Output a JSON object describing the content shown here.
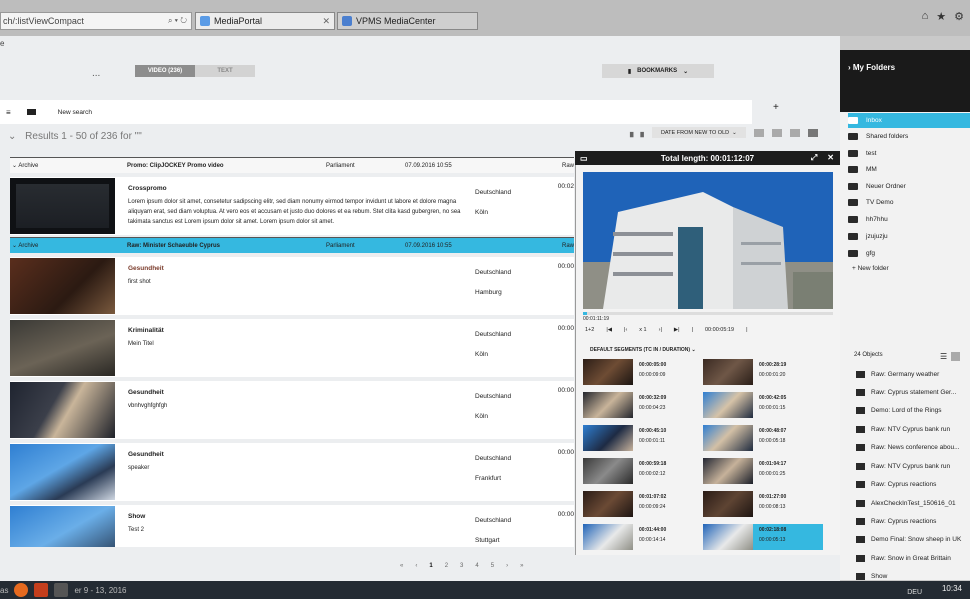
{
  "browser": {
    "address": "ch/:listViewCompact",
    "tabs": [
      {
        "label": "MediaPortal"
      },
      {
        "label": "VPMS MediaCenter"
      }
    ],
    "toolbar_icons": [
      "home-icon",
      "star-icon",
      "gear-icon"
    ]
  },
  "app": {
    "menu_char": "e",
    "tabs": {
      "video": "VIDEO (236)",
      "text": "TEXT"
    },
    "bookmarks": "BOOKMARKS",
    "ellipsis": "...",
    "new_search": "New search",
    "plus": "+",
    "results": "Results 1 - 50 of 236 for \"\"",
    "sort": "DATE FROM NEW TO OLD"
  },
  "list": {
    "rows": [
      {
        "archive": "Archive",
        "title": "Promo: ClipJOCKEY Promo video",
        "source": "Parliament",
        "date": "07.09.2016 10:55",
        "type": "Raw",
        "detail": {
          "title": "Crosspromo",
          "desc": "Lorem ipsum dolor sit amet, consetetur sadipscing elitr, sed diam nonumy eirmod tempor invidunt ut labore et dolore magna aliquyam erat, sed diam voluptua. At vero eos et accusam et justo duo dolores et ea rebum. Stet clita kasd gubergren, no sea takimata sanctus est Lorem ipsum dolor sit amet. Lorem ipsum dolor sit amet.",
          "country": "Deutschland",
          "city": "Köln",
          "duration": "00:02"
        }
      },
      {
        "archive": "Archive",
        "title": "Raw: Minister Schaeuble Cyprus",
        "source": "Parliament",
        "date": "07.09.2016 10:55",
        "type": "Raw",
        "detail": {
          "title": "Gesundheit",
          "desc": "first shot",
          "country": "Deutschland",
          "city": "Hamburg",
          "duration": "00:00"
        }
      }
    ],
    "items": [
      {
        "title": "Kriminalität",
        "desc": "Mein Titel",
        "country": "Deutschland",
        "city": "Köln",
        "duration": "00:00"
      },
      {
        "title": "Gesundheit",
        "desc": "vbnhvghfghfgh",
        "country": "Deutschland",
        "city": "Köln",
        "duration": "00:00"
      },
      {
        "title": "Gesundheit",
        "desc": "speaker",
        "country": "Deutschland",
        "city": "Frankfurt",
        "duration": "00:00"
      },
      {
        "title": "Show",
        "desc": "Test 2",
        "country": "Deutschland",
        "city": "Stuttgart",
        "duration": "00:00"
      }
    ],
    "pagination": {
      "first": "«",
      "prev": "‹",
      "pages": [
        "1",
        "2",
        "3",
        "4",
        "5"
      ],
      "next": "›",
      "last": "»"
    }
  },
  "player": {
    "total": "Total length: 00:01:12:07",
    "current": "00:01:11:19",
    "speed_ratio": "1+2",
    "speed": "x 1",
    "position": "00:00:05:19",
    "segments_label": "DEFAULT SEGMENTS (TC IN / DURATION)",
    "segments": [
      {
        "tc": "00:00:05:00",
        "dur": "00:00:09:09"
      },
      {
        "tc": "00:00:28:19",
        "dur": "00:00:01:20"
      },
      {
        "tc": "00:00:32:09",
        "dur": "00:00:04:23"
      },
      {
        "tc": "00:00:42:05",
        "dur": "00:00:01:15"
      },
      {
        "tc": "00:00:45:10",
        "dur": "00:00:01:11"
      },
      {
        "tc": "00:00:48:07",
        "dur": "00:00:05:18"
      },
      {
        "tc": "00:00:59:18",
        "dur": "00:00:02:12"
      },
      {
        "tc": "00:01:04:17",
        "dur": "00:00:01:25"
      },
      {
        "tc": "00:01:07:02",
        "dur": "00:00:09:24"
      },
      {
        "tc": "00:01:27:00",
        "dur": "00:00:08:13"
      },
      {
        "tc": "00:01:44:00",
        "dur": "00:00:14:14"
      },
      {
        "tc": "00:02:18:08",
        "dur": "00:00:05:13"
      }
    ]
  },
  "folders": {
    "title": "My Folders",
    "items": [
      "Inbox",
      "Shared folders",
      "test",
      "MM",
      "Neuer Ordner",
      "TV Demo",
      "hh7hhu",
      "jzujuzju",
      "gfg"
    ],
    "new_folder": "New folder",
    "objects_count": "24 Objects",
    "objects": [
      "Raw: Germany weather",
      "Raw: Cyprus statement Ger...",
      "Demo: Lord of the Rings",
      "Raw: NTV Cyprus bank run",
      "Raw: News conference abou...",
      "Raw: NTV Cyprus bank run",
      "Raw: Cyprus reactions",
      "AlexCheckInTest_150616_01",
      "Raw: Cyprus reactions",
      "Demo Final: Snow sheep in UK",
      "Raw: Snow in Great Brittain",
      "Show"
    ]
  },
  "taskbar": {
    "left_text": "as",
    "running": "er 9 - 13, 2016",
    "lang": "DEU",
    "time": "10:34"
  },
  "colors": {
    "accent": "#35b8e0",
    "header": "#1d1d1d",
    "background": "#eceef0"
  }
}
